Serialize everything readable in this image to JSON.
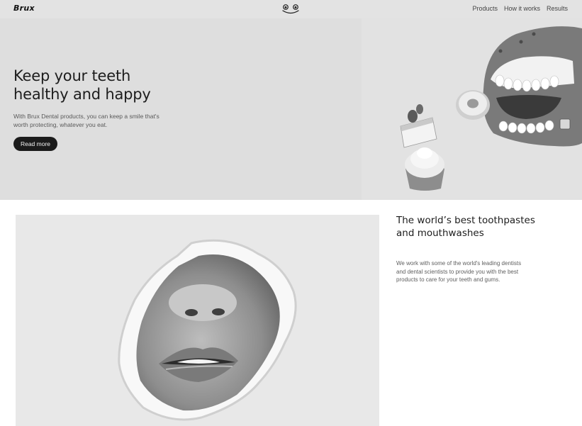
{
  "nav": {
    "brand": "Brux",
    "logo_icon": "smiley-face-icon",
    "links": [
      "Products",
      "How it works",
      "Results"
    ]
  },
  "hero": {
    "title": "Keep your teeth healthy and happy",
    "subtitle": "With Brux Dental products, you can keep a smile that's worth protecting, whatever you eat.",
    "cta_label": "Read more",
    "image": "wind-up-teeth-toy-with-donut-and-desserts-photo"
  },
  "feature": {
    "title": "The world’s best toothpastes and mouthwashes",
    "body": "We work with some of the world's leading dentists and dental scientists to provide you with the best products to care for your teeth and gums.",
    "image": "lips-through-torn-paper-photo"
  }
}
